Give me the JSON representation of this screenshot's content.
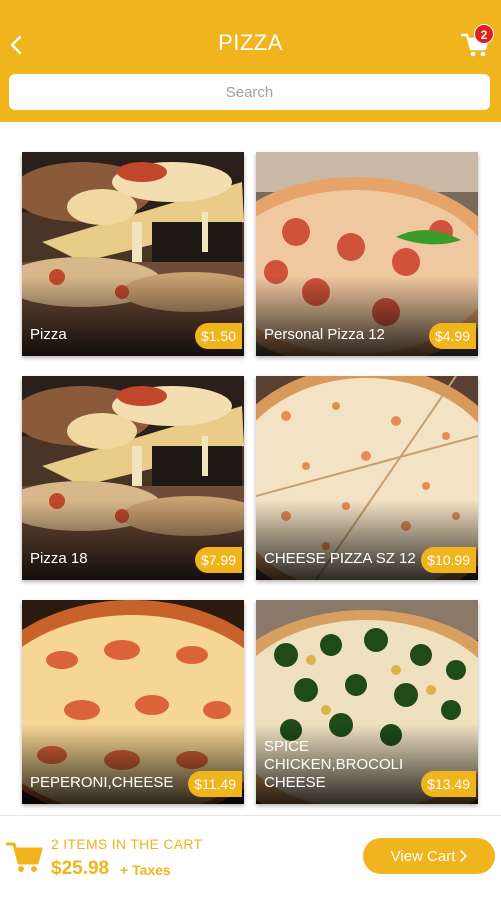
{
  "header": {
    "title": "PIZZA",
    "back_icon": "chevron-left-icon",
    "cart_icon": "shopping-cart-icon",
    "cart_badge": "2"
  },
  "search": {
    "placeholder": "Search"
  },
  "products": [
    {
      "name": "Pizza",
      "price": "$1.50"
    },
    {
      "name": "Personal Pizza 12",
      "price": "$4.99"
    },
    {
      "name": "Pizza 18",
      "price": "$7.99"
    },
    {
      "name": "CHEESE PIZZA SZ 12",
      "price": "$10.99"
    },
    {
      "name": "PEPERONI,CHEESE",
      "price": "$11.49"
    },
    {
      "name": "SPICE CHICKEN,BROCOLI CHEESE",
      "price": "$13.49"
    }
  ],
  "footer": {
    "items_text": "2 ITEMS IN THE CART",
    "total": "$25.98",
    "taxes": "+ Taxes",
    "view_cart_label": "View Cart",
    "view_cart_icon": "chevron-right-icon"
  },
  "colors": {
    "accent": "#f0b41c",
    "badge": "#e02020"
  }
}
